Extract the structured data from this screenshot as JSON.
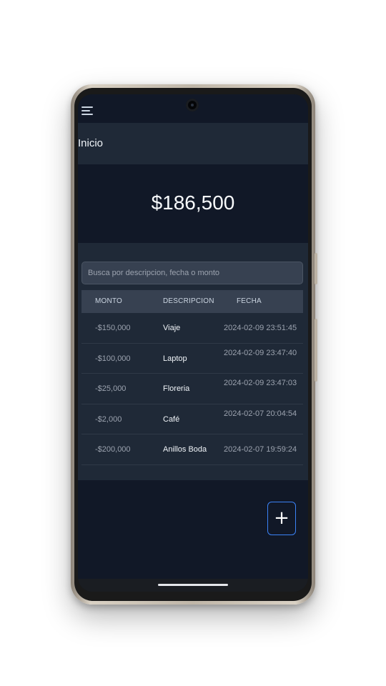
{
  "header": {
    "title": "Inicio"
  },
  "balance": {
    "value": "$186,500"
  },
  "search": {
    "placeholder": "Busca por descripcion, fecha o monto"
  },
  "table": {
    "columns": [
      "MONTO",
      "DESCRIPCION",
      "FECHA"
    ],
    "rows": [
      {
        "amount": "-$150,000",
        "description": "Viaje",
        "date": "2024-02-09 23:51:45"
      },
      {
        "amount": "-$100,000",
        "description": "Laptop",
        "date": "2024-02-09 23:47:40"
      },
      {
        "amount": "-$25,000",
        "description": "Floreria",
        "date": "2024-02-09 23:47:03"
      },
      {
        "amount": "-$2,000",
        "description": "Café",
        "date": "2024-02-07 20:04:54"
      },
      {
        "amount": "-$200,000",
        "description": "Anillos Boda",
        "date": "2024-02-07 19:59:24"
      }
    ]
  },
  "fab": {
    "label": "+"
  },
  "icons": {
    "menu": "hamburger-menu-icon",
    "add": "plus-icon"
  },
  "colors": {
    "background": "#111827",
    "panel": "#1f2937",
    "accent": "#3b82f6"
  }
}
